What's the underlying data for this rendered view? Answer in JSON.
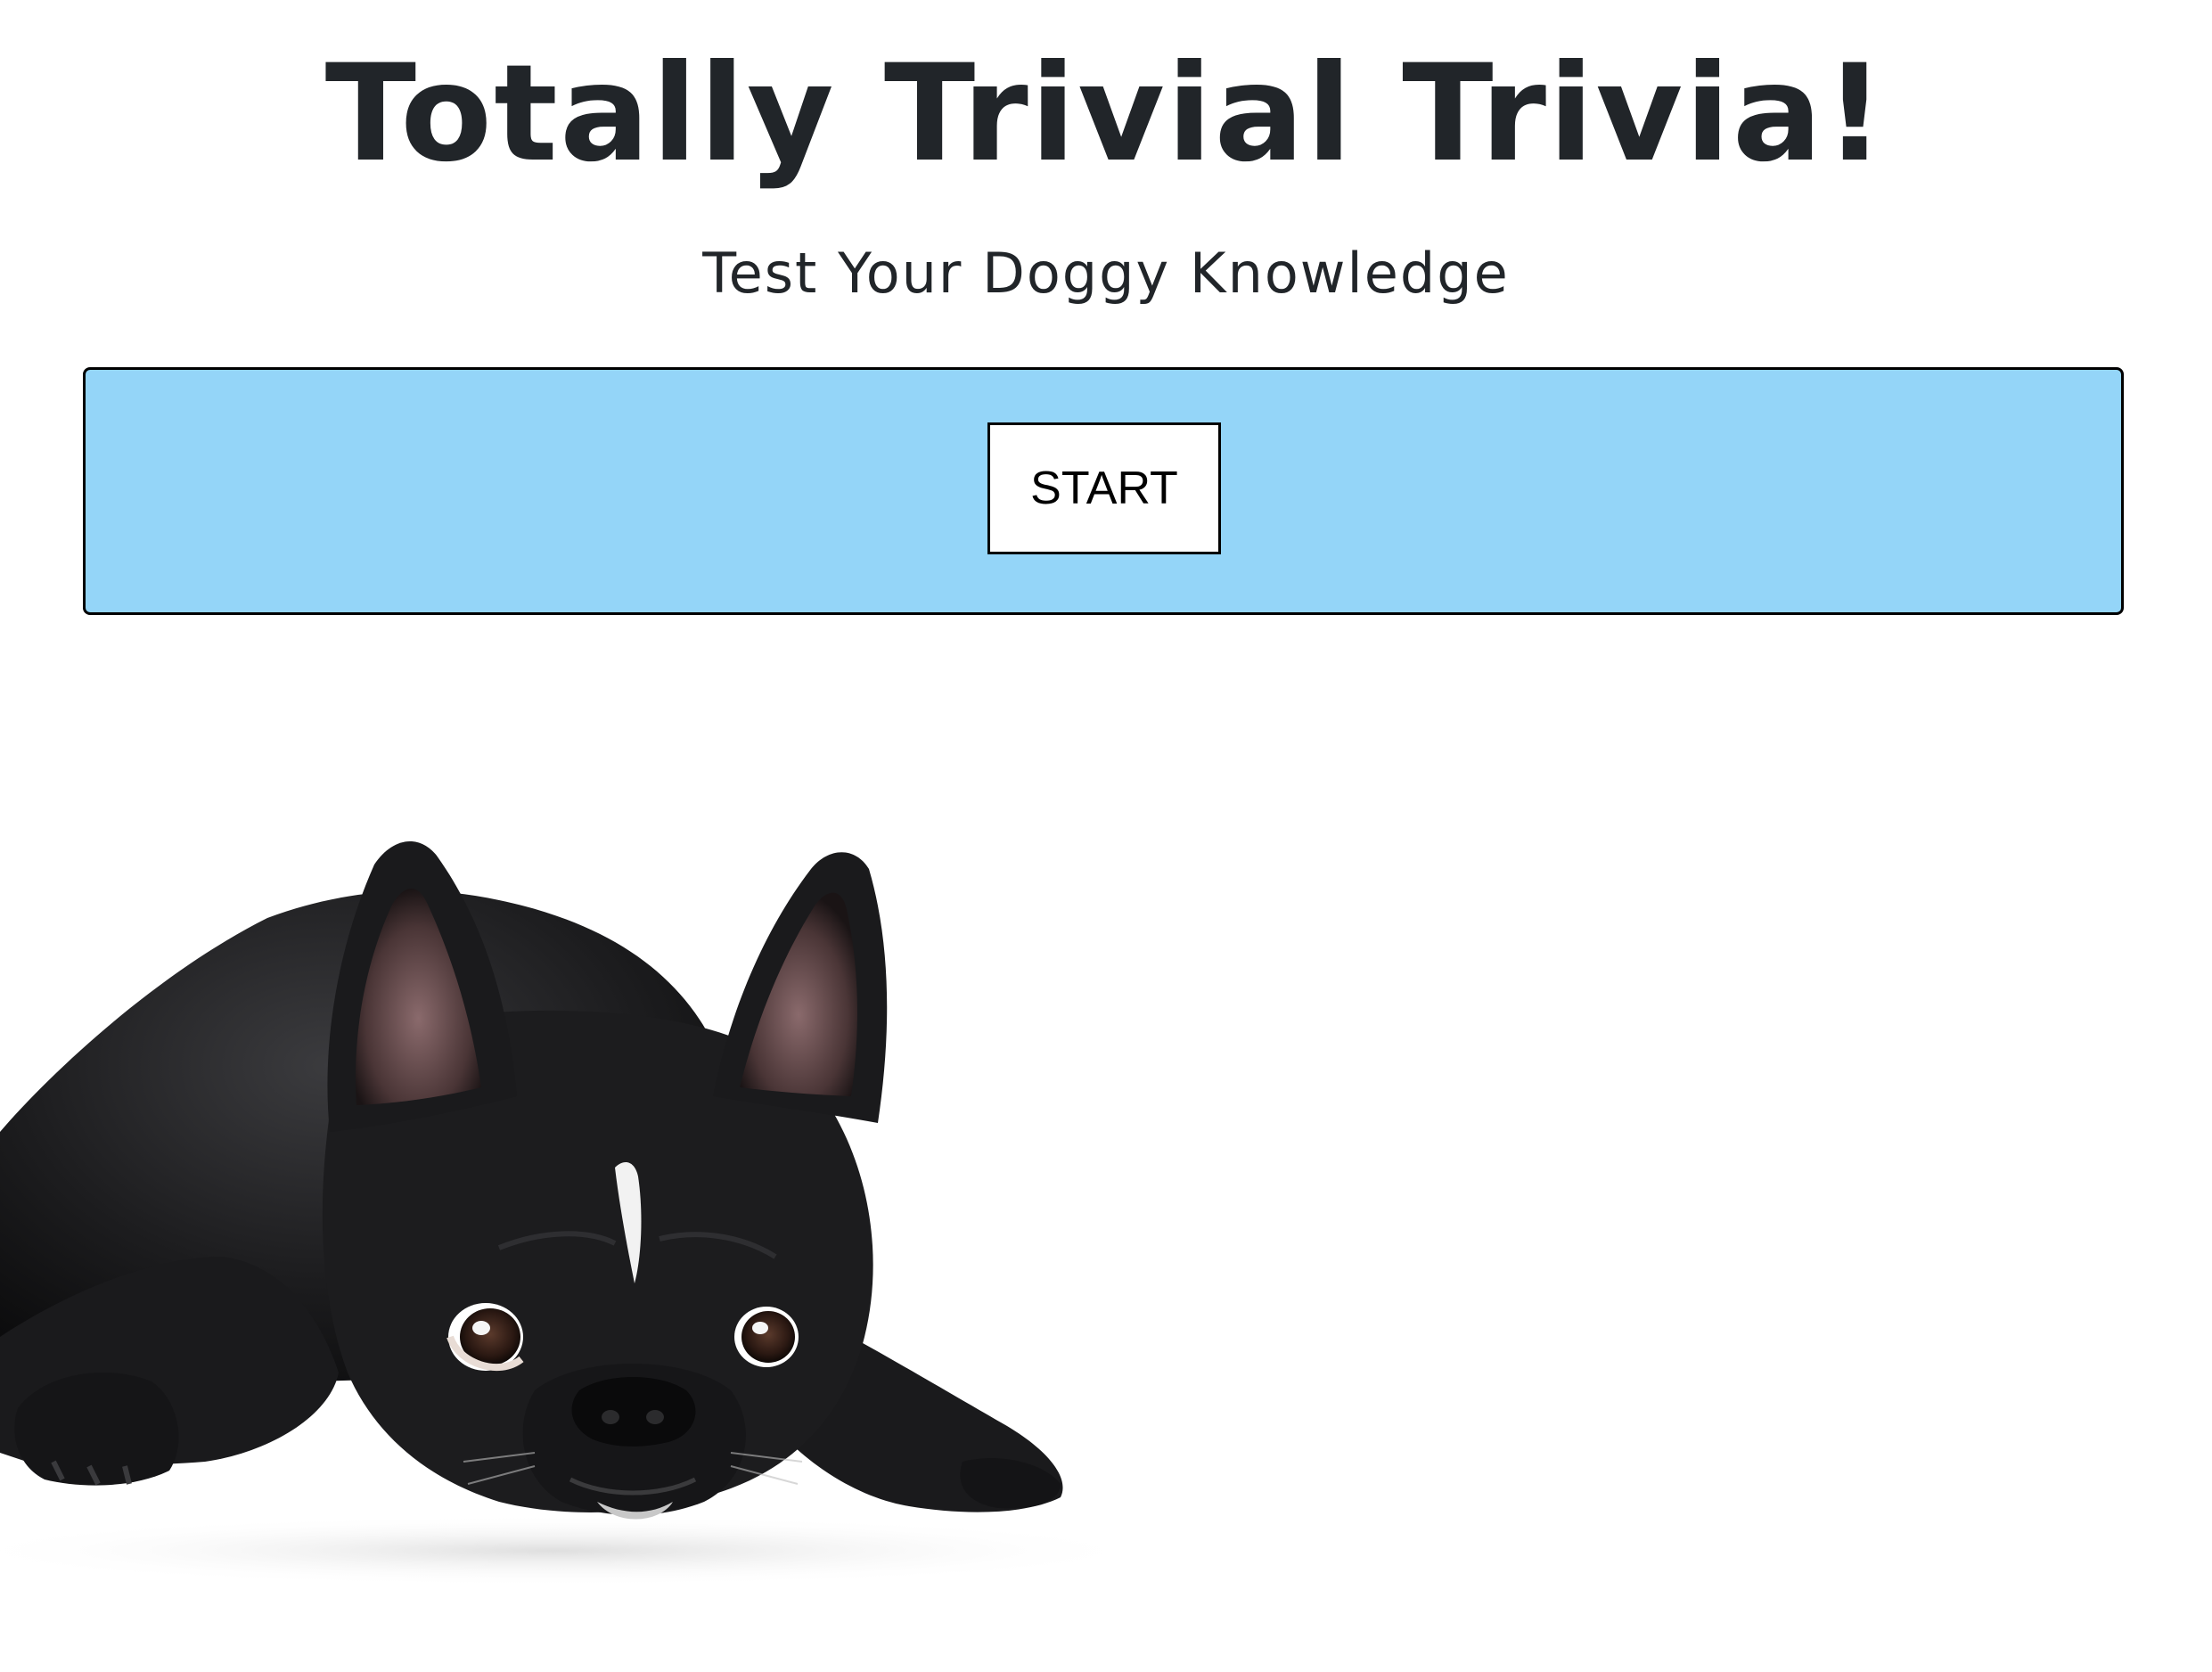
{
  "header": {
    "title": "Totally Trivial Trivia!",
    "subtitle": "Test Your Doggy Knowledge"
  },
  "quiz": {
    "start_label": "START",
    "panel_color": "#94d5f8"
  },
  "image": {
    "subject": "black french bulldog lying down"
  }
}
